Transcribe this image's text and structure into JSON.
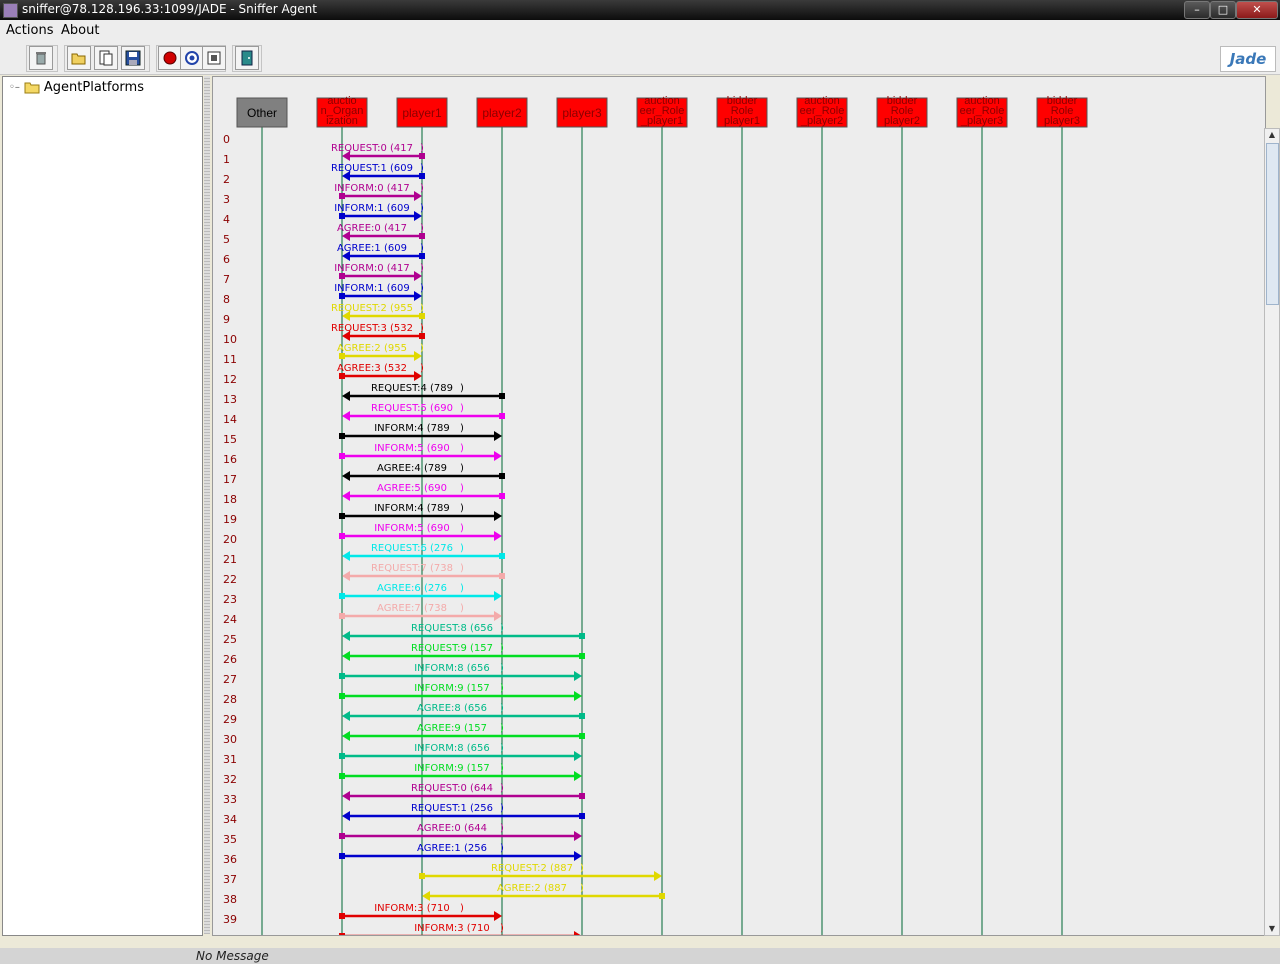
{
  "window": {
    "title": "sniffer@78.128.196.33:1099/JADE - Sniffer Agent"
  },
  "menu": {
    "items": [
      "Actions",
      "About"
    ]
  },
  "toolbar": {
    "icons": [
      "clear-canvas-icon",
      "open-file-icon",
      "write-message-list-icon",
      "save-icon",
      "do-sniff-icon",
      "show-only-icon",
      "do-not-sniff-icon",
      "exit-icon"
    ],
    "logo": "Jade"
  },
  "tree": {
    "root_label": "AgentPlatforms"
  },
  "agents": [
    {
      "label": "Other",
      "lines": [
        "Other"
      ]
    },
    {
      "label": "auctio n_Organ ization",
      "lines": [
        "auctio",
        "n_Organ",
        "ization"
      ]
    },
    {
      "label": "player1",
      "lines": [
        "player1"
      ]
    },
    {
      "label": "player2",
      "lines": [
        "player2"
      ]
    },
    {
      "label": "player3",
      "lines": [
        "player3"
      ]
    },
    {
      "label": "auction eer_Role _player1",
      "lines": [
        "auction",
        "eer_Role",
        "_player1"
      ]
    },
    {
      "label": "bidder Role player1",
      "lines": [
        "bidder",
        "Role",
        "player1"
      ]
    },
    {
      "label": "auction eer_Role _player2",
      "lines": [
        "auction",
        "eer_Role",
        "_player2"
      ]
    },
    {
      "label": "bidder Role player2",
      "lines": [
        "bidder",
        "Role",
        "player2"
      ]
    },
    {
      "label": "auction eer_Role _player3",
      "lines": [
        "auction",
        "eer_Role",
        "_player3"
      ]
    },
    {
      "label": "bidder Role player3",
      "lines": [
        "bidder",
        "Role",
        "player3"
      ]
    }
  ],
  "colors": {
    "agent_other": "#808080",
    "agent_box": "#ff0000",
    "lifeline": "#006633",
    "row_number": "#8b0000"
  },
  "messages": [
    {
      "label": "REQUEST:0 (417",
      "from": 2,
      "to": 1,
      "color": "#b00090"
    },
    {
      "label": "REQUEST:1 (609",
      "from": 2,
      "to": 1,
      "color": "#0000cc"
    },
    {
      "label": "INFORM:0 (417",
      "from": 1,
      "to": 2,
      "color": "#b00090"
    },
    {
      "label": "INFORM:1 (609",
      "from": 1,
      "to": 2,
      "color": "#0000cc"
    },
    {
      "label": "AGREE:0 (417",
      "from": 2,
      "to": 1,
      "color": "#b00090"
    },
    {
      "label": "AGREE:1 (609",
      "from": 2,
      "to": 1,
      "color": "#0000cc"
    },
    {
      "label": "INFORM:0 (417",
      "from": 1,
      "to": 2,
      "color": "#b00090"
    },
    {
      "label": "INFORM:1 (609",
      "from": 1,
      "to": 2,
      "color": "#0000cc"
    },
    {
      "label": "REQUEST:2 (955",
      "from": 2,
      "to": 1,
      "color": "#e0d800"
    },
    {
      "label": "REQUEST:3 (532",
      "from": 2,
      "to": 1,
      "color": "#e00000"
    },
    {
      "label": "AGREE:2 (955",
      "from": 1,
      "to": 2,
      "color": "#e0d800"
    },
    {
      "label": "AGREE:3 (532",
      "from": 1,
      "to": 2,
      "color": "#e00000"
    },
    {
      "label": "REQUEST:4 (789",
      "from": 3,
      "to": 1,
      "color": "#000000"
    },
    {
      "label": "REQUEST:5 (690",
      "from": 3,
      "to": 1,
      "color": "#ee00ee"
    },
    {
      "label": "INFORM:4 (789",
      "from": 1,
      "to": 3,
      "color": "#000000"
    },
    {
      "label": "INFORM:5 (690",
      "from": 1,
      "to": 3,
      "color": "#ee00ee"
    },
    {
      "label": "AGREE:4 (789",
      "from": 3,
      "to": 1,
      "color": "#000000"
    },
    {
      "label": "AGREE:5 (690",
      "from": 3,
      "to": 1,
      "color": "#ee00ee"
    },
    {
      "label": "INFORM:4 (789",
      "from": 1,
      "to": 3,
      "color": "#000000"
    },
    {
      "label": "INFORM:5 (690",
      "from": 1,
      "to": 3,
      "color": "#ee00ee"
    },
    {
      "label": "REQUEST:6 (276",
      "from": 3,
      "to": 1,
      "color": "#00e8e8"
    },
    {
      "label": "REQUEST:7 (738",
      "from": 3,
      "to": 1,
      "color": "#f4aaaa"
    },
    {
      "label": "AGREE:6 (276",
      "from": 1,
      "to": 3,
      "color": "#00e8e8"
    },
    {
      "label": "AGREE:7 (738",
      "from": 1,
      "to": 3,
      "color": "#f4aaaa"
    },
    {
      "label": "REQUEST:8 (656",
      "from": 4,
      "to": 1,
      "color": "#00bb88"
    },
    {
      "label": "REQUEST:9 (157",
      "from": 4,
      "to": 1,
      "color": "#00dd22"
    },
    {
      "label": "INFORM:8 (656",
      "from": 1,
      "to": 4,
      "color": "#00bb88"
    },
    {
      "label": "INFORM:9 (157",
      "from": 1,
      "to": 4,
      "color": "#00dd22"
    },
    {
      "label": "AGREE:8 (656",
      "from": 4,
      "to": 1,
      "color": "#00bb88"
    },
    {
      "label": "AGREE:9 (157",
      "from": 4,
      "to": 1,
      "color": "#00dd22"
    },
    {
      "label": "INFORM:8 (656",
      "from": 1,
      "to": 4,
      "color": "#00bb88"
    },
    {
      "label": "INFORM:9 (157",
      "from": 1,
      "to": 4,
      "color": "#00dd22"
    },
    {
      "label": "REQUEST:0 (644",
      "from": 4,
      "to": 1,
      "color": "#b00090"
    },
    {
      "label": "REQUEST:1 (256",
      "from": 4,
      "to": 1,
      "color": "#0000cc"
    },
    {
      "label": "AGREE:0 (644",
      "from": 1,
      "to": 4,
      "color": "#b00090"
    },
    {
      "label": "AGREE:1 (256",
      "from": 1,
      "to": 4,
      "color": "#0000cc"
    },
    {
      "label": "REQUEST:2 (887",
      "from": 2,
      "to": 5,
      "color": "#e0d800"
    },
    {
      "label": "AGREE:2 (887",
      "from": 5,
      "to": 2,
      "color": "#e0d800"
    },
    {
      "label": "INFORM:3 (710",
      "from": 1,
      "to": 3,
      "color": "#e00000"
    },
    {
      "label": "INFORM:3 (710",
      "from": 1,
      "to": 4,
      "color": "#e00000"
    }
  ],
  "status": {
    "message": "No Message"
  }
}
